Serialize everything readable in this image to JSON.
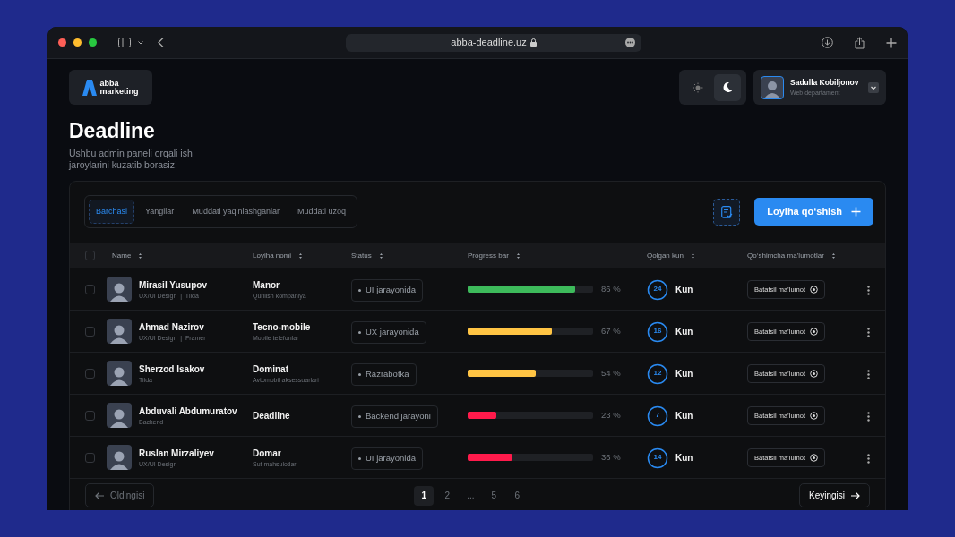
{
  "browser": {
    "url": "abba-deadline.uz"
  },
  "header": {
    "logo": [
      "abba",
      "marketing"
    ],
    "theme": [
      {
        "kind": "light",
        "selected": false
      },
      {
        "kind": "dark",
        "selected": true
      }
    ],
    "user": {
      "name": "Sadulla Kobiljonov",
      "role": "Web departament"
    }
  },
  "page": {
    "title": "Deadline",
    "subtitle": "Ushbu admin paneli orqali ish jaroylarini kuzatib borasiz!"
  },
  "filters": [
    {
      "label": "Barchasi",
      "selected": true
    },
    {
      "label": "Yangilar",
      "selected": false
    },
    {
      "label": "Muddati yaqinlashganlar",
      "selected": false
    },
    {
      "label": "Muddati uzoq",
      "selected": false
    }
  ],
  "add_button": "Loyiha qo‘shish",
  "table": {
    "select_all": {
      "checked": false
    },
    "columns": [
      "Name",
      "Loyiha nomi",
      "Status",
      "Progress bar",
      "Qolgan kun",
      "Qo‘shimcha ma’lumotlar"
    ],
    "rows": [
      {
        "checked": false,
        "name": "Mirasil Yusupov",
        "role": "UX/UI Design  |  Tilda",
        "project": "Manor",
        "project_sub": "Qurilish kompaniya",
        "status": "UI jarayonida",
        "level": 0.86,
        "reading": "86 %",
        "color": "#3dba5b",
        "remaining": {
          "days": "24",
          "unit": "Kun"
        },
        "details": "Batafsil ma’lumot"
      },
      {
        "checked": false,
        "name": "Ahmad Nazirov",
        "role": "UX/UI Design  |  Framer",
        "project": "Tecno-mobile",
        "project_sub": "Mobile telefonlar",
        "status": "UX jarayonida",
        "level": 0.67,
        "reading": "67 %",
        "color": "#ffc444",
        "remaining": {
          "days": "16",
          "unit": "Kun"
        },
        "details": "Batafsil ma’lumot"
      },
      {
        "checked": false,
        "name": "Sherzod Isakov",
        "role": "Tilda",
        "project": "Dominat",
        "project_sub": "Avtomobil aksessuarlari",
        "status": "Razrabotka",
        "level": 0.54,
        "reading": "54 %",
        "color": "#ffc444",
        "remaining": {
          "days": "12",
          "unit": "Kun"
        },
        "details": "Batafsil ma’lumot"
      },
      {
        "checked": false,
        "name": "Abduvali Abdumuratov",
        "role": "Backend",
        "project": "Deadline",
        "status": "Backend jarayoni",
        "level": 0.23,
        "reading": "23 %",
        "color": "#ff1a4b",
        "remaining": {
          "days": "7",
          "unit": "Kun"
        },
        "details": "Batafsil ma’lumot"
      },
      {
        "checked": false,
        "name": "Ruslan Mirzaliyev",
        "role": "UX/UI Design",
        "project": "Domar",
        "project_sub": "Sut mahsulotlar",
        "status": "UI jarayonida",
        "level": 0.36,
        "reading": "36 %",
        "color": "#ff1a4b",
        "remaining": {
          "days": "14",
          "unit": "Kun"
        },
        "details": "Batafsil ma’lumot"
      }
    ]
  },
  "pagination": {
    "prev": "Oldingisi",
    "next": "Keyingisi",
    "pages": [
      {
        "label": "1",
        "selected": true
      },
      {
        "label": "2",
        "selected": false
      },
      {
        "label": "...",
        "selected": false
      },
      {
        "label": "5",
        "selected": false
      },
      {
        "label": "6",
        "selected": false
      }
    ]
  }
}
